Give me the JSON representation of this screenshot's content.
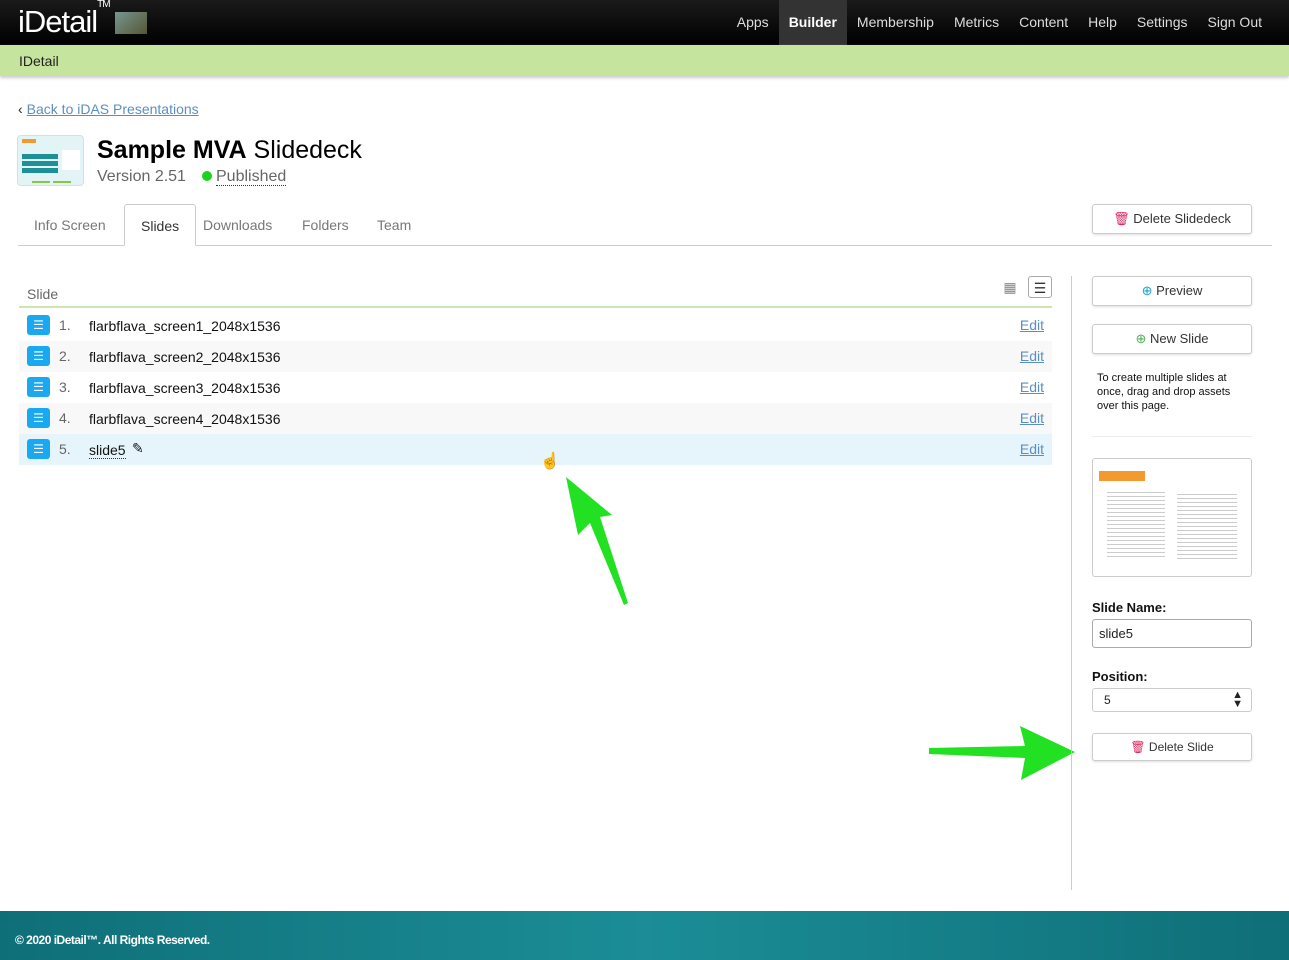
{
  "header": {
    "logo": "iDetail",
    "logo_tm": "TM",
    "nav": [
      "Apps",
      "Builder",
      "Membership",
      "Metrics",
      "Content",
      "Help",
      "Settings",
      "Sign Out"
    ],
    "active_nav": "Builder"
  },
  "subbar": {
    "title": "IDetail"
  },
  "back_link": "Back to iDAS Presentations",
  "deck": {
    "title_bold": "Sample MVA",
    "title_rest": "Slidedeck",
    "version": "Version 2.51",
    "status": "Published",
    "status_color": "#1ed31e"
  },
  "tabs": [
    "Info Screen",
    "Slides",
    "Downloads",
    "Folders",
    "Team"
  ],
  "active_tab": "Slides",
  "delete_slidedeck": "Delete Slidedeck",
  "list": {
    "header": "Slide",
    "edit_label": "Edit",
    "rows": [
      {
        "num": "1.",
        "name": "flarbflava_screen1_2048x1536"
      },
      {
        "num": "2.",
        "name": "flarbflava_screen2_2048x1536"
      },
      {
        "num": "3.",
        "name": "flarbflava_screen3_2048x1536"
      },
      {
        "num": "4.",
        "name": "flarbflava_screen4_2048x1536"
      },
      {
        "num": "5.",
        "name": "slide5"
      }
    ],
    "selected": "5."
  },
  "sidebar": {
    "preview": "Preview",
    "new_slide": "New Slide",
    "help": "To create multiple slides at once, drag and drop assets over this page.",
    "slide_name_label": "Slide Name:",
    "slide_name_value": "slide5",
    "position_label": "Position:",
    "position_value": "5",
    "delete_slide": "Delete Slide"
  },
  "footer": "© 2020 iDetail™. All Rights Reserved.",
  "colors": {
    "accent": "#1aa9f0",
    "link": "#5b8fc0",
    "subbar": "#c5e49e",
    "arrow": "#22e022",
    "delete": "#e0245e"
  }
}
